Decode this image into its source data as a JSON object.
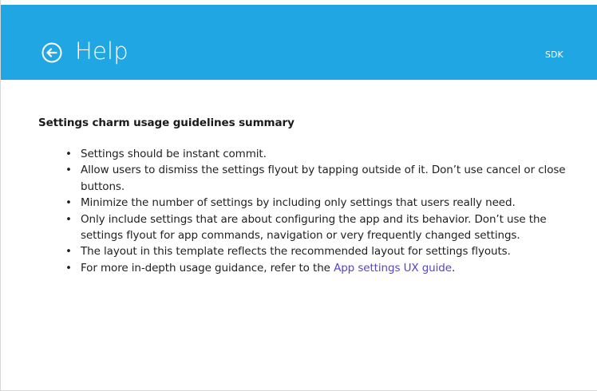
{
  "header": {
    "title": "Help",
    "sdk_label": "SDK",
    "back_icon": "back-arrow-circle-icon",
    "background_color": "#1fa6e3"
  },
  "content": {
    "heading": "Settings charm usage guidelines summary",
    "bullets": [
      "Settings should be instant commit.",
      "Allow users to dismiss the settings flyout by tapping outside of it. Don’t use cancel or close buttons.",
      "Minimize the number of settings by including only settings that users really need.",
      "Only include settings that are about configuring the app and its behavior. Don’t use the settings flyout for app commands, navigation or very frequently changed settings.",
      "The layout in this template reflects the recommended layout for settings flyouts."
    ],
    "last_bullet": {
      "prefix": "For more in-depth usage guidance, refer to the ",
      "link_text": "App settings UX guide",
      "suffix": "."
    },
    "bullet_char": "•",
    "link_color": "#5b3fd1"
  }
}
